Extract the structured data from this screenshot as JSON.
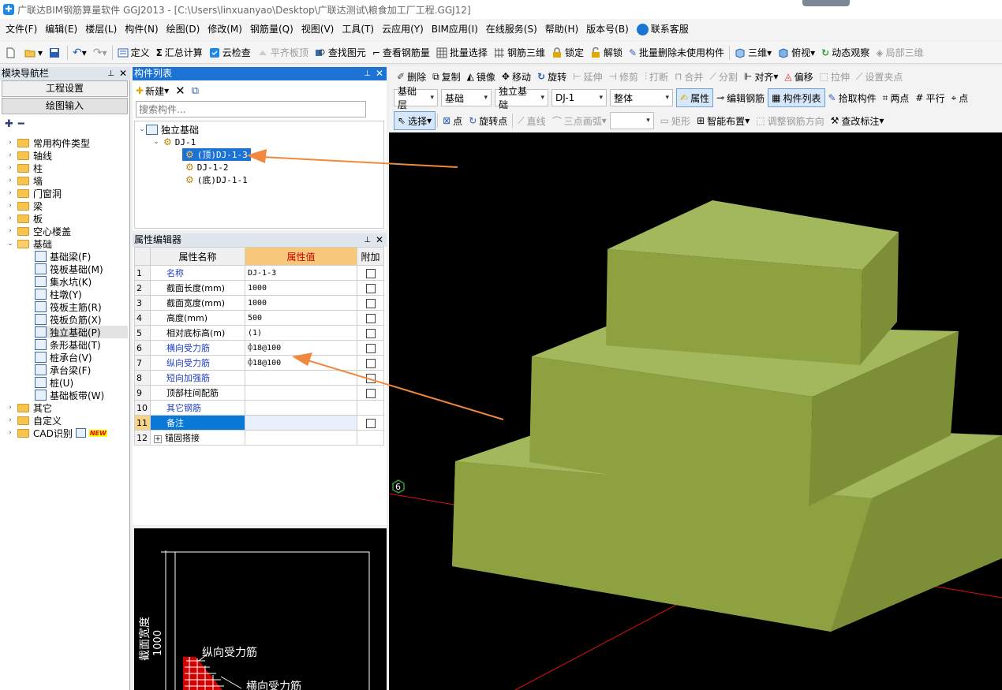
{
  "title": "广联达BIM钢筋算量软件 GGJ2013 - [C:\\Users\\linxuanyao\\Desktop\\广联达测试\\粮食加工厂工程.GGJ12]",
  "menu": [
    "文件(F)",
    "编辑(E)",
    "楼层(L)",
    "构件(N)",
    "绘图(D)",
    "修改(M)",
    "钢筋量(Q)",
    "视图(V)",
    "工具(T)",
    "云应用(Y)",
    "BIM应用(I)",
    "在线服务(S)",
    "帮助(H)",
    "版本号(B)"
  ],
  "menu_service": "联系客服",
  "toolbar1": [
    "定义",
    "汇总计算",
    "云检查",
    "平齐板顶",
    "查找图元",
    "查看钢筋量",
    "批量选择",
    "钢筋三维",
    "锁定",
    "解锁",
    "批量删除未使用构件",
    "三维",
    "俯视",
    "动态观察",
    "局部三维"
  ],
  "nav": {
    "title": "模块导航栏",
    "btn_project": "工程设置",
    "btn_draw": "绘图输入",
    "folders_top": [
      "常用构件类型",
      "轴线",
      "柱",
      "墙",
      "门窗洞",
      "梁",
      "板",
      "空心楼盖",
      "基础"
    ],
    "foundation_items": [
      "基础梁(F)",
      "筏板基础(M)",
      "集水坑(K)",
      "柱墩(Y)",
      "筏板主筋(R)",
      "筏板负筋(X)",
      "独立基础(P)",
      "条形基础(T)",
      "桩承台(V)",
      "承台梁(F)",
      "桩(U)",
      "基础板带(W)"
    ],
    "folders_bottom": [
      "其它",
      "自定义",
      "CAD识别"
    ],
    "new_badge": "NEW"
  },
  "complist": {
    "title": "构件列表",
    "new_label": "新建",
    "search_placeholder": "搜索构件...",
    "root": "独立基础",
    "child": "DJ-1",
    "leaves": [
      "(顶)DJ-1-3",
      "DJ-1-2",
      "(底)DJ-1-1"
    ]
  },
  "propedit": {
    "title": "属性编辑器",
    "headers": [
      "属性名称",
      "属性值",
      "附加"
    ],
    "rows": [
      {
        "n": "1",
        "name": "名称",
        "value": "DJ-1-3"
      },
      {
        "n": "2",
        "name": "截面长度(mm)",
        "value": "1000"
      },
      {
        "n": "3",
        "name": "截面宽度(mm)",
        "value": "1000"
      },
      {
        "n": "4",
        "name": "高度(mm)",
        "value": "500"
      },
      {
        "n": "5",
        "name": "相对底标高(m)",
        "value": "(1)"
      },
      {
        "n": "6",
        "name": "横向受力筋",
        "value": "⌽18@100"
      },
      {
        "n": "7",
        "name": "纵向受力筋",
        "value": "⌽18@100"
      },
      {
        "n": "8",
        "name": "短向加强筋",
        "value": ""
      },
      {
        "n": "9",
        "name": "顶部柱间配筋",
        "value": ""
      },
      {
        "n": "10",
        "name": "其它钢筋",
        "value": ""
      },
      {
        "n": "11",
        "name": "备注",
        "value": ""
      },
      {
        "n": "12",
        "name": "锚固搭接",
        "value": ""
      }
    ]
  },
  "preview": {
    "dim_label": "截面宽度",
    "dim_value": "1000",
    "label_long": "纵向受力筋",
    "label_trans": "横向受力筋"
  },
  "righttb": {
    "row1": [
      "删除",
      "复制",
      "镜像",
      "移动",
      "旋转",
      "延伸",
      "修剪",
      "打断",
      "合并",
      "分割",
      "对齐",
      "偏移",
      "拉伸",
      "设置夹点"
    ],
    "combos": [
      "基础层",
      "基础",
      "独立基础",
      "DJ-1",
      "整体"
    ],
    "row2": [
      "属性",
      "编辑钢筋",
      "构件列表",
      "拾取构件",
      "两点",
      "平行",
      "点"
    ],
    "row3": [
      "选择",
      "点",
      "旋转点",
      "直线",
      "三点画弧",
      "矩形",
      "智能布置",
      "调整钢筋方向",
      "查改标注"
    ]
  },
  "viewport": {
    "axis_label": "6"
  },
  "colors": {
    "accent": "#1c73d4",
    "block_top": "#a3b75c",
    "block_front": "#8da141",
    "block_side": "#7c8f36",
    "arrow": "#f0883e"
  }
}
